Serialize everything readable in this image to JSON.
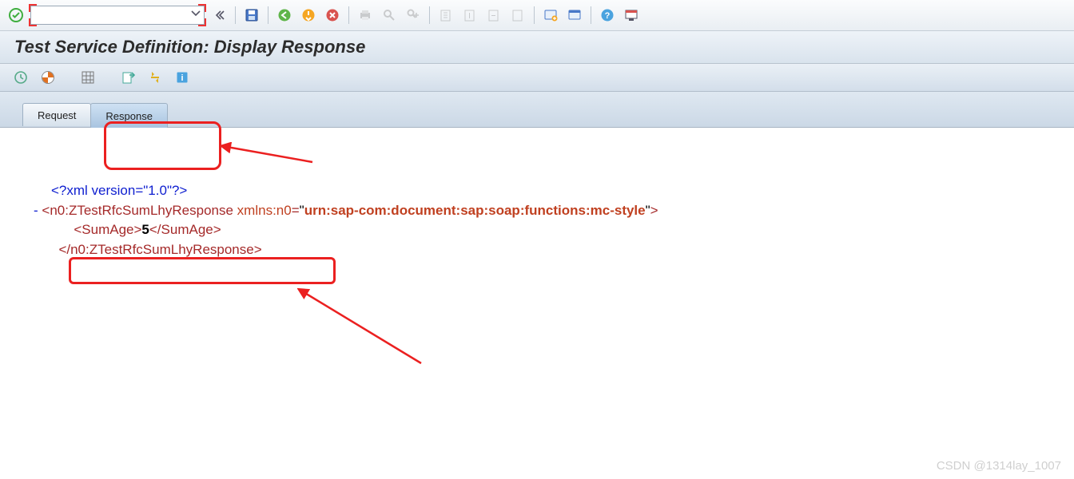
{
  "title": "Test Service Definition: Display Response",
  "tabs": {
    "request": "Request",
    "response": "Response"
  },
  "xml": {
    "pi": "<?xml version=\"1.0\"?>",
    "root_open_a": "<n0:ZTestRfcSumLhyResponse",
    "root_attr_name": "xmlns:n0",
    "root_attr_val": "urn:sap-com:document:sap:soap:functions:mc-style",
    "child_open": "<SumAge>",
    "child_val": "5",
    "child_close": "</SumAge>",
    "root_close": "</n0:ZTestRfcSumLhyResponse>"
  },
  "watermark": "CSDN @1314lay_1007"
}
